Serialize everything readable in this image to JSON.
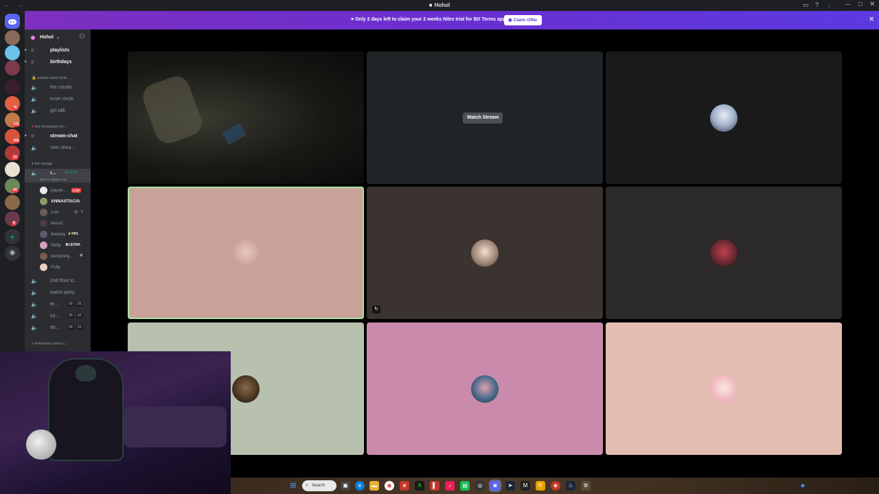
{
  "window": {
    "title": "Hohol",
    "nav_arrows": "← →"
  },
  "banner": {
    "text": "Only 2 days left to claim your 2 weeks Nitro trial for $0! Terms apply.",
    "button_label": "Claim Offer"
  },
  "server": {
    "name": "Hohol"
  },
  "rail_badges": [
    "76",
    "143",
    "188",
    "12",
    "94",
    "8"
  ],
  "channels": [
    {
      "label": "playlists",
      "type": "text",
      "bold": true
    },
    {
      "label": "birthdays",
      "type": "text",
      "bold": true
    }
  ],
  "category_private": "private zone (only ...",
  "private_channels": [
    {
      "label": "the usuals"
    },
    {
      "label": "inner circle"
    },
    {
      "label": "girl talk"
    }
  ],
  "category_live": "live broadcast (m...",
  "live_channels": [
    {
      "label": "stream-chat",
      "type": "text",
      "bold": true
    },
    {
      "label": "now strea...",
      "type": "voice"
    }
  ],
  "category_lounge": "the lounge",
  "active_voice": {
    "label": "r...",
    "timer": "46:47:51",
    "sub": "back to square one"
  },
  "members": [
    {
      "name": "papaii...",
      "live": "LIVE"
    },
    {
      "name": "ANNASTACIA"
    },
    {
      "name": "cuki"
    },
    {
      "name": "dess2."
    },
    {
      "name": "duaney",
      "tag": "HHL"
    },
    {
      "name": "Nefly",
      "tag": "LEONA"
    },
    {
      "name": "pompong..."
    },
    {
      "name": "Polly"
    }
  ],
  "voice_channels": [
    {
      "label": "2nd floor lo..."
    },
    {
      "label": "watch party"
    },
    {
      "label": "te...",
      "count_a": "00",
      "count_b": "03"
    },
    {
      "label": "co...",
      "count_a": "00",
      "count_b": "02"
    },
    {
      "label": "do...",
      "count_a": "00",
      "count_b": "01"
    }
  ],
  "category_temp": "temporary voice c...",
  "stage": {
    "watch_stream_label": "Watch Stream"
  },
  "taskbar": {
    "search_label": "Search"
  },
  "colors": {
    "tile_pink": "#c9a198",
    "tile_brown": "#3a3330",
    "tile_dark": "#2b2929",
    "tile_sage": "#b8c0ae",
    "tile_magenta": "#c98aab",
    "tile_peach": "#e4bdb2",
    "tile_stream": "#1f2527",
    "accent_green": "#a8e6a0",
    "banner_purple": "#6a2fd0"
  }
}
